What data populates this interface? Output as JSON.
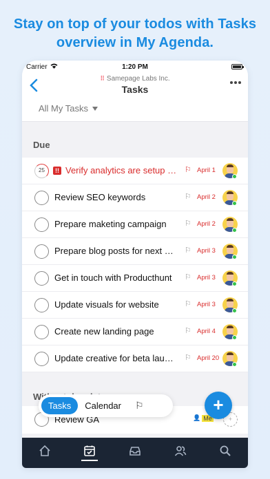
{
  "headline": [
    "Stay on top of your todos with Tasks",
    "overview in My Agenda."
  ],
  "statusbar": {
    "carrier": "Carrier",
    "time": "1:20 PM"
  },
  "navbar": {
    "back_icon": "‹",
    "org": "Samepage Labs Inc.",
    "title": "Tasks",
    "more_icon": "more-icon"
  },
  "filter": {
    "label": "All My Tasks"
  },
  "sections": {
    "due": {
      "title": "Due"
    },
    "nodue": {
      "title": "Without due date"
    }
  },
  "tasks_due": [
    {
      "name": "Verify analytics are setup for new landing page",
      "due": "April 1",
      "overdue": true,
      "progress": "25",
      "priority": "!!"
    },
    {
      "name": "Review SEO keywords",
      "due": "April 2"
    },
    {
      "name": "Prepare maketing campaign",
      "due": "April 2"
    },
    {
      "name": "Prepare blog posts for next week",
      "due": "April 3"
    },
    {
      "name": "Get in touch with Producthunt",
      "due": "April 3"
    },
    {
      "name": "Update visuals for website",
      "due": "April 3"
    },
    {
      "name": "Create new landing page",
      "due": "April 4"
    },
    {
      "name": "Update creative for beta launch",
      "due": "April 20"
    }
  ],
  "tasks_nodue": [
    {
      "name": "Review GA",
      "assignee": "Me"
    }
  ],
  "segment": {
    "tasks": "Tasks",
    "calendar": "Calendar",
    "flag_icon": "flag-icon"
  },
  "fab": {
    "label": "+"
  },
  "colors": {
    "accent": "#1a8be0",
    "overdue": "#d92c2c",
    "tabbar": "#1b2534"
  }
}
